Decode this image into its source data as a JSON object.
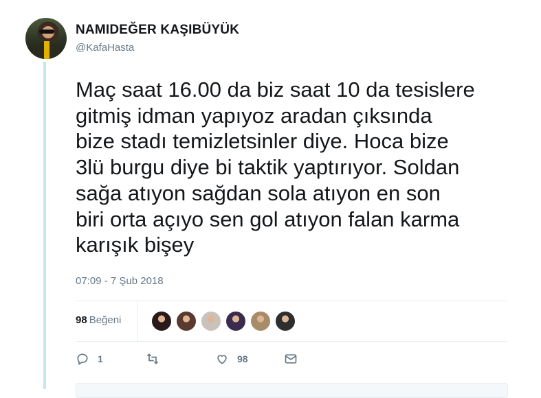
{
  "author": {
    "display_name": "NAMIDEĞER KAŞIBÜYÜK",
    "handle": "@KafaHasta"
  },
  "tweet": {
    "text": "Maç saat 16.00 da biz saat 10 da tesislere\ngitmiş idman yapıyoz aradan çıksında\nbize stadı temizletsinler diye. Hoca bize\n3lü burgu diye bi taktik yaptırıyor. Soldan\nsağa atıyon sağdan sola atıyon en son\nbiri orta açıyo sen gol atıyon falan karma\nkarışık bişey",
    "timestamp": "07:09 - 7 Şub 2018"
  },
  "stats": {
    "likes_count": "98",
    "likes_label": "Beğeni",
    "likers": [
      {
        "name": "liker-avatar-1",
        "color": "#2b1a1a"
      },
      {
        "name": "liker-avatar-2",
        "color": "#5a3a2e"
      },
      {
        "name": "liker-avatar-3",
        "color": "#c9c2bb"
      },
      {
        "name": "liker-avatar-4",
        "color": "#3a2c4e"
      },
      {
        "name": "liker-avatar-5",
        "color": "#a88c6a"
      },
      {
        "name": "liker-avatar-6",
        "color": "#2e2e2e"
      }
    ]
  },
  "actions": {
    "reply_count": "1",
    "retweet_count": "",
    "like_count": "98",
    "icons": [
      "reply-icon",
      "retweet-icon",
      "heart-icon",
      "message-icon"
    ]
  },
  "colors": {
    "thread_line": "#c4e6f7",
    "secondary_text": "#657786",
    "primary_text": "#14171a"
  }
}
